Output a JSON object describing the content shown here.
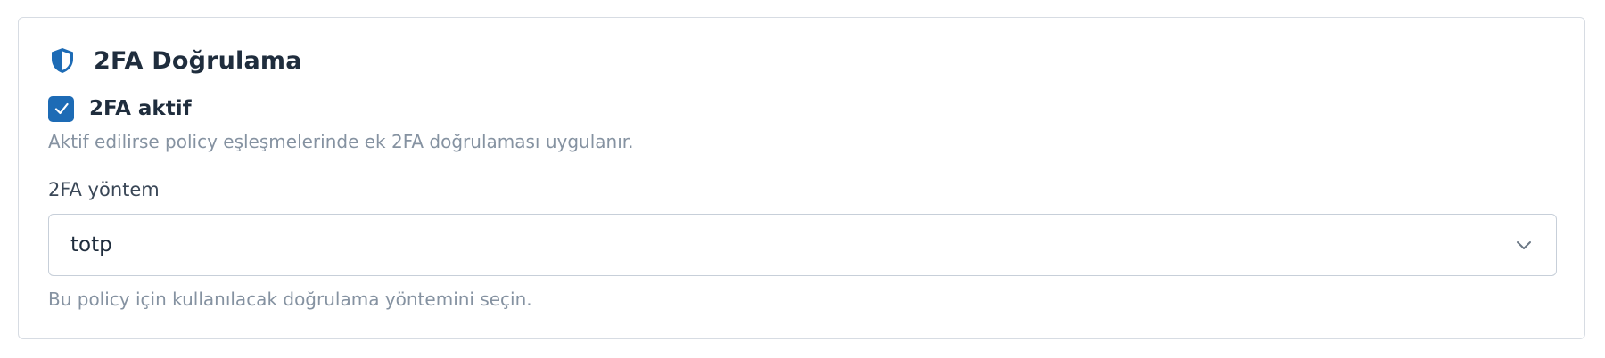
{
  "section": {
    "title": "2FA Doğrulama",
    "icon": "shield-icon",
    "accent_color": "#1d6bb5"
  },
  "enable_2fa": {
    "label": "2FA aktif",
    "checked": true,
    "hint": "Aktif edilirse policy eşleşmelerinde ek 2FA doğrulaması uygulanır."
  },
  "method": {
    "label": "2FA yöntem",
    "selected_value": "totp",
    "hint": "Bu policy için kullanılacak doğrulama yöntemini seçin.",
    "icon": "chevron-down-icon"
  }
}
